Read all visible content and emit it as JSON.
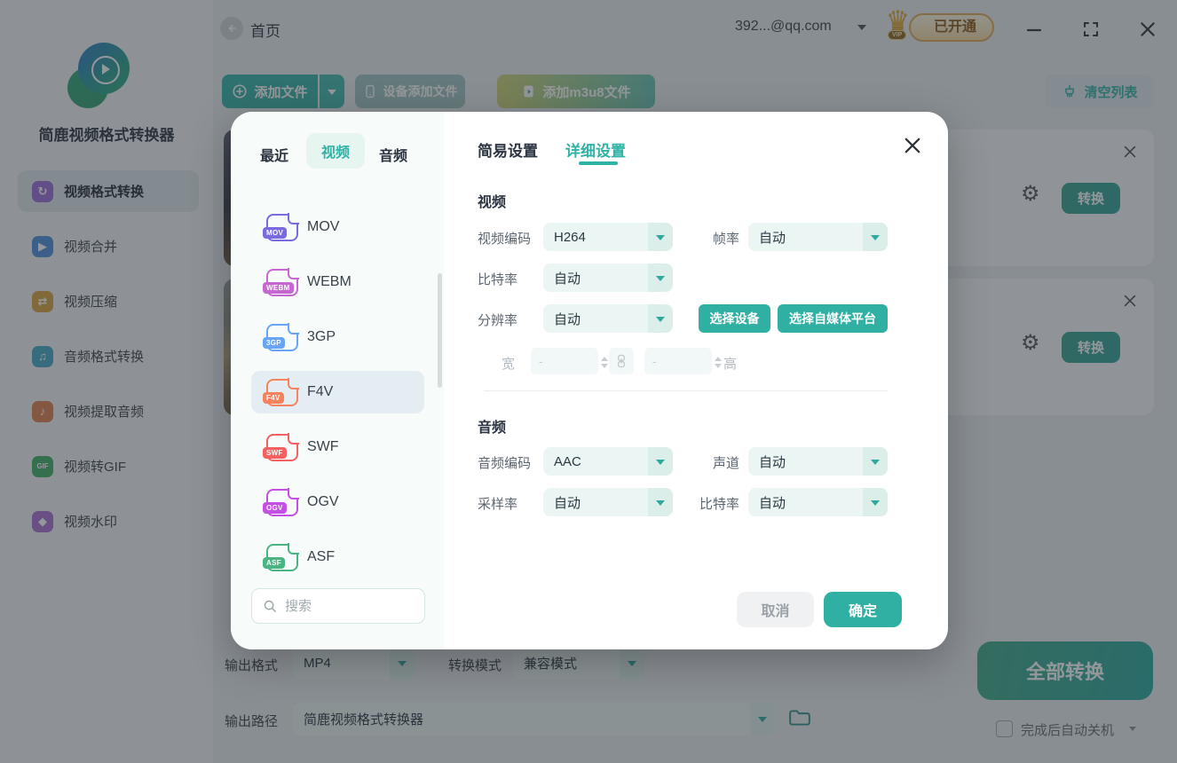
{
  "app_title": "简鹿视频格式转换器",
  "topbar": {
    "home": "首页",
    "account": "392...@qq.com",
    "vip": "已开通",
    "vip_tag": "VIP"
  },
  "toolbar": {
    "add_file": "添加文件",
    "device_add_file": "设备添加文件",
    "add_m3u8": "添加m3u8文件",
    "clear_list": "清空列表"
  },
  "sidebar": {
    "items": [
      {
        "label": "视频格式转换",
        "icon": "convert-icon",
        "glyph": "↻",
        "color": "#9a6fd8",
        "active": true
      },
      {
        "label": "视频合并",
        "icon": "merge-icon",
        "glyph": "▶",
        "color": "#4f8fdd",
        "active": false
      },
      {
        "label": "视频压缩",
        "icon": "compress-icon",
        "glyph": "⇄",
        "color": "#d8a43f",
        "active": false
      },
      {
        "label": "音频格式转换",
        "icon": "audio-convert-icon",
        "glyph": "♫",
        "color": "#45a8c8",
        "active": false
      },
      {
        "label": "视频提取音频",
        "icon": "extract-audio-icon",
        "glyph": "♪",
        "color": "#dd7e4d",
        "active": false
      },
      {
        "label": "视频转GIF",
        "icon": "gif-icon",
        "glyph": "GIF",
        "color": "#3fae66",
        "active": false
      },
      {
        "label": "视频水印",
        "icon": "watermark-icon",
        "glyph": "◆",
        "color": "#a86fd0",
        "active": false
      }
    ]
  },
  "file_cards": [
    {
      "convert": "转换"
    },
    {
      "convert": "转换"
    }
  ],
  "output_bar": {
    "format_label": "输出格式",
    "format_value": "MP4",
    "mode_label": "转换模式",
    "mode_value": "兼容模式",
    "path_label": "输出路径",
    "path_value": "简鹿视频格式转换器",
    "convert_all": "全部转换",
    "auto_shutdown": "完成后自动关机"
  },
  "modal": {
    "list_tabs": [
      {
        "label": "最近",
        "active": false
      },
      {
        "label": "视频",
        "active": true
      },
      {
        "label": "音频",
        "active": false
      }
    ],
    "formats": [
      {
        "name": "MOV",
        "color": "#7a6ae0",
        "selected": false
      },
      {
        "name": "WEBM",
        "color": "#c667d1",
        "selected": false
      },
      {
        "name": "3GP",
        "color": "#68a5f6",
        "selected": false
      },
      {
        "name": "F4V",
        "color": "#f6825e",
        "selected": true
      },
      {
        "name": "SWF",
        "color": "#f56060",
        "selected": false
      },
      {
        "name": "OGV",
        "color": "#c44fe4",
        "selected": false
      },
      {
        "name": "ASF",
        "color": "#4bb483",
        "selected": false
      }
    ],
    "search_placeholder": "搜索",
    "settings_tabs": [
      {
        "label": "简易设置",
        "active": false
      },
      {
        "label": "详细设置",
        "active": true
      }
    ],
    "video": {
      "title": "视频",
      "encode_label": "视频编码",
      "encode_value": "H264",
      "fps_label": "帧率",
      "fps_value": "自动",
      "bitrate_label": "比特率",
      "bitrate_value": "自动",
      "resolution_label": "分辨率",
      "resolution_value": "自动",
      "select_device": "选择设备",
      "select_platform": "选择自媒体平台",
      "width_label": "宽",
      "height_label": "高",
      "width_value": "-",
      "height_value": "-"
    },
    "audio": {
      "title": "音频",
      "encode_label": "音频编码",
      "encode_value": "AAC",
      "channel_label": "声道",
      "channel_value": "自动",
      "sample_label": "采样率",
      "sample_value": "自动",
      "bitrate_label": "比特率",
      "bitrate_value": "自动"
    },
    "cancel": "取消",
    "ok": "确定"
  },
  "colors": {
    "accent": "#2fb0a3",
    "accent_dark": "#35b3a7",
    "vip_gold": "#dca856",
    "selected_row": "#e4eef2"
  }
}
